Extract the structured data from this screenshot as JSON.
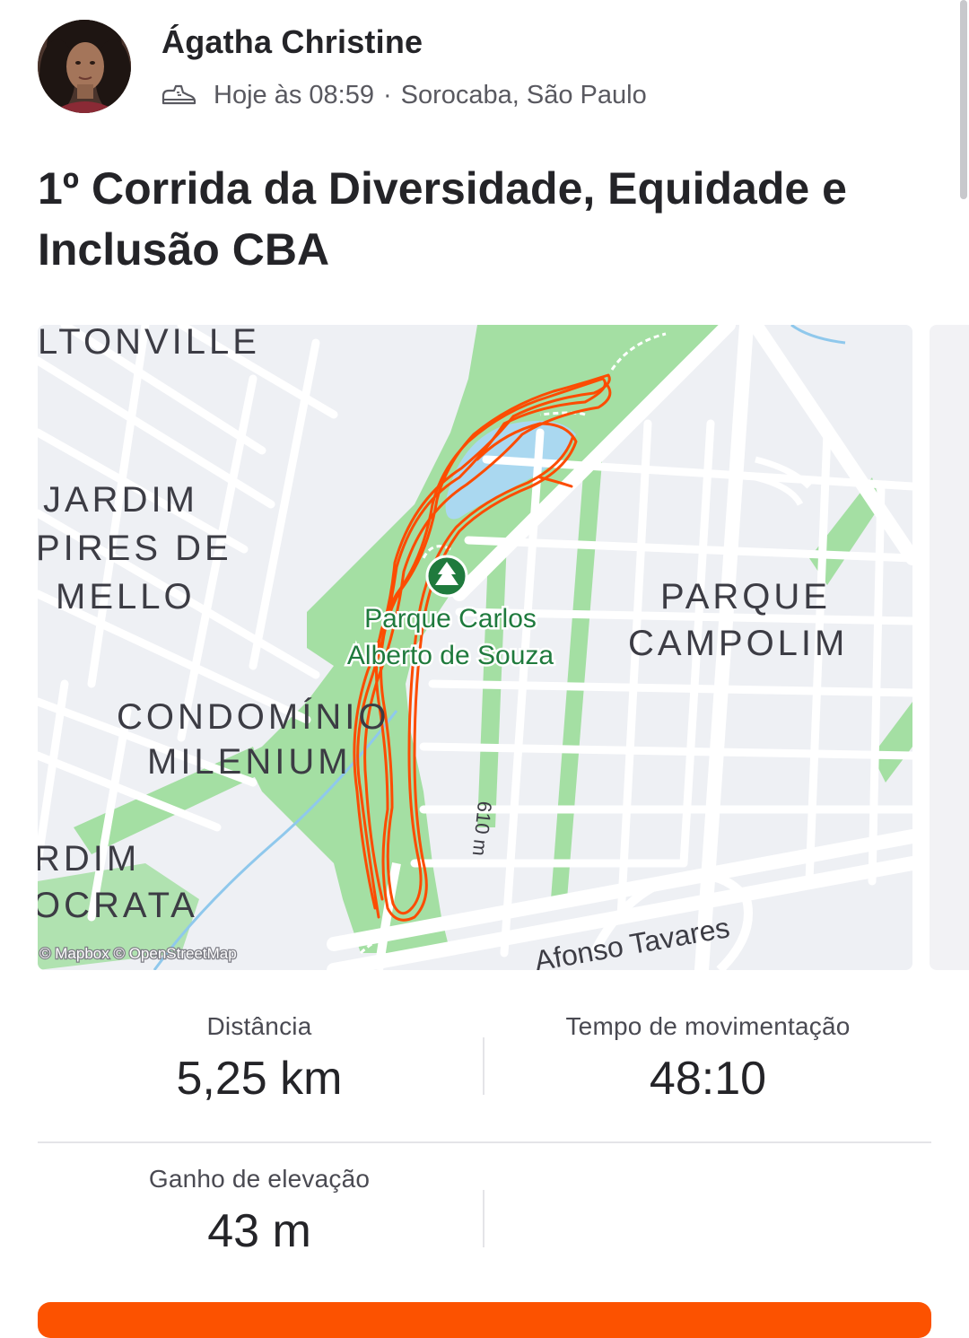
{
  "athlete": {
    "name": "Ágatha Christine",
    "time": "Hoje às 08:59",
    "separator": "·",
    "location": "Sorocaba, São Paulo"
  },
  "activity": {
    "title": "1º Corrida da Diversidade, Equidade e Inclusão CBA",
    "sport_icon": "shoe-icon"
  },
  "map": {
    "neighborhoods": [
      "LTONVILLE",
      "JARDIM",
      "PIRES DE",
      "MELLO",
      "CONDOMÍNIO",
      "MILENIUM",
      "RDIM",
      "OCRATA",
      "PARQUE",
      "CAMPOLIM"
    ],
    "park_line1": "Parque Carlos",
    "park_line2": "Alberto de Souza",
    "park_icon": "tree-icon",
    "road_label": "Afonso Tavares",
    "street_label": "610 m",
    "attribution": "© Mapbox © OpenStreetMap",
    "route_color": "#fc4c02",
    "park_color": "#a4dfa3",
    "water_color": "#aad8f0"
  },
  "stats": {
    "distance_label": "Distância",
    "distance_value": "5,25 km",
    "moving_time_label": "Tempo de movimentação",
    "moving_time_value": "48:10",
    "elevation_label": "Ganho de elevação",
    "elevation_value": "43 m"
  },
  "colors": {
    "accent": "#fc5200"
  }
}
